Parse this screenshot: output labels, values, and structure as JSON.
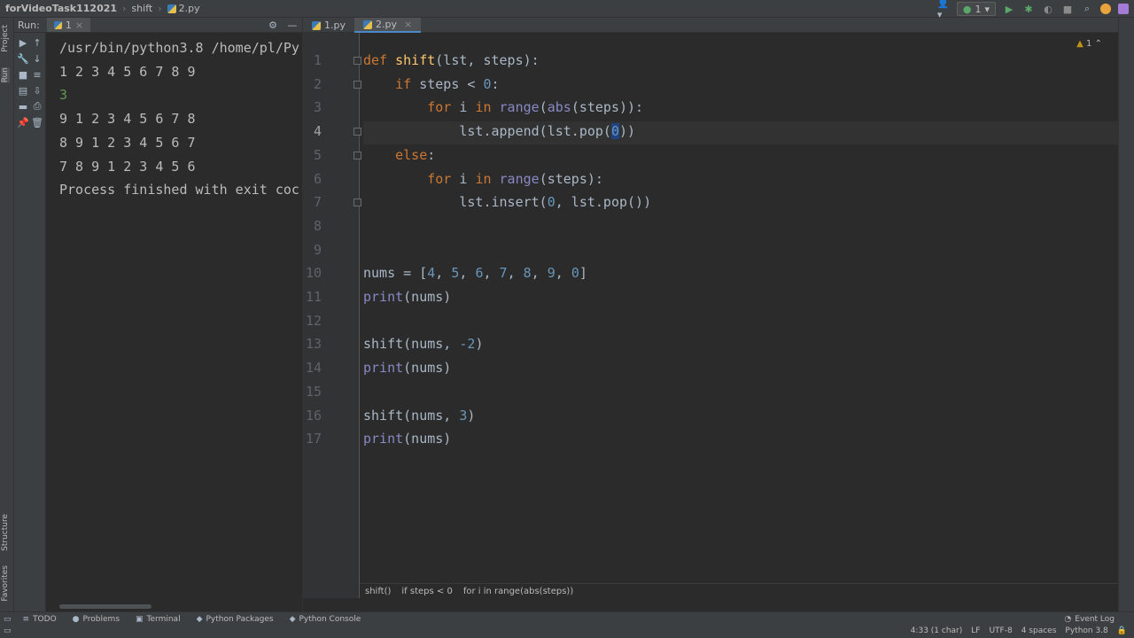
{
  "navbar": {
    "project": "forVideoTask11202​1",
    "crumb_folder": "shift",
    "crumb_file": "2.py",
    "run_config": "1"
  },
  "run_panel": {
    "label": "Run:",
    "tab": "1",
    "console_lines": [
      "/usr/bin/python3.8 /home/pl/Py",
      "1 2 3 4 5 6 7 8 9",
      "3",
      "9 1 2 3 4 5 6 7 8",
      "8 9 1 2 3 4 5 6 7",
      "7 8 9 1 2 3 4 5 6",
      "",
      "Process finished with exit coc"
    ]
  },
  "editor": {
    "tabs": [
      {
        "label": "1.py",
        "active": false
      },
      {
        "label": "2.py",
        "active": true
      }
    ],
    "line_numbers": [
      "1",
      "2",
      "3",
      "4",
      "5",
      "6",
      "7",
      "8",
      "9",
      "10",
      "11",
      "12",
      "13",
      "14",
      "15",
      "16",
      "17"
    ],
    "inspection": "1",
    "breadcrumbs": [
      "shift()",
      "if steps < 0",
      "for i in range(abs(steps))"
    ]
  },
  "left_strip": {
    "project": "Project",
    "run": "Run",
    "structure": "Structure",
    "favorites": "Favorites"
  },
  "bottom_tools": [
    {
      "label": "TODO",
      "icon": "list-icon"
    },
    {
      "label": "Problems",
      "icon": "problems-icon"
    },
    {
      "label": "Terminal",
      "icon": "terminal-icon"
    },
    {
      "label": "Python Packages",
      "icon": "packages-icon"
    },
    {
      "label": "Python Console",
      "icon": "console-icon"
    }
  ],
  "status": {
    "event_log": "Event Log",
    "position": "4:33 (1 char)",
    "line_sep": "LF",
    "encoding": "UTF-8",
    "indent": "4 spaces",
    "interpreter": "Python 3.8"
  },
  "colors": {
    "keyword": "#cc7832",
    "function": "#ffc66d",
    "builtin": "#8888c6",
    "number": "#6897bb",
    "text": "#a9b7c6",
    "input": "#629755"
  }
}
